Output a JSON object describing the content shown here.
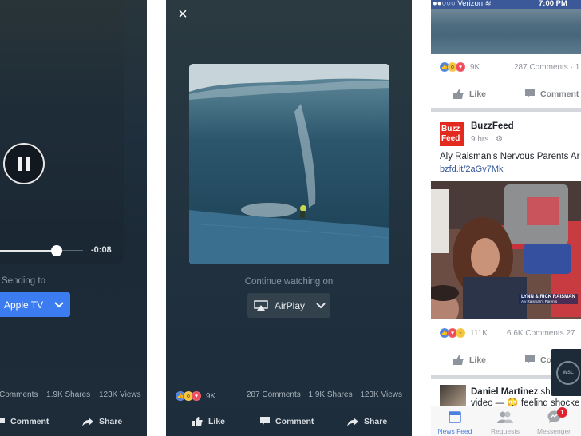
{
  "left_phone": {
    "playback": {
      "time_remaining": "-0:08",
      "progress_percent": 68
    },
    "cast": {
      "label": "Sending to",
      "device": "Apple TV"
    },
    "stats": {
      "comments": "Comments",
      "shares": "1.9K Shares",
      "views": "123K Views"
    },
    "actions": {
      "comment": "Comment",
      "share": "Share"
    }
  },
  "middle_phone": {
    "close_icon": "×",
    "cast": {
      "label": "Continue watching on",
      "device": "AirPlay"
    },
    "reactions": {
      "icons": [
        "like",
        "wow",
        "love"
      ],
      "count": "9K"
    },
    "stats": {
      "comments": "287 Comments",
      "shares": "1.9K Shares",
      "views": "123K Views"
    },
    "actions": {
      "like": "Like",
      "comment": "Comment",
      "share": "Share"
    }
  },
  "right_phone": {
    "status_bar": {
      "carrier": "●●○○○ Verizon",
      "time": "7:00 PM"
    },
    "post1": {
      "reactions": {
        "icons": [
          "like",
          "wow",
          "love"
        ],
        "count": "9K"
      },
      "comments": "287 Comments · 1",
      "actions": {
        "like": "Like",
        "comment": "Comment"
      }
    },
    "post2": {
      "logo_line1": "Buzz",
      "logo_line2": "Feed",
      "author": "BuzzFeed",
      "meta": "9 hrs · ⚙",
      "text": "Aly Raisman's Nervous Parents Ar",
      "link": "bzfd.it/2aGv7Mk",
      "photo_caption": "LYNN & RICK RAISMAN",
      "photo_subcaption": "Aly Raisman's Parents",
      "reactions": {
        "icons": [
          "like",
          "love",
          "haha"
        ],
        "count": "111K"
      },
      "comments": "6.6K Comments  27",
      "actions": {
        "like": "Like",
        "comment": "Co"
      }
    },
    "post3": {
      "author": "Daniel Martinez",
      "text_suffix": " sh",
      "line2": "video — 😳 feeling shocke"
    },
    "pip_label": "WSL",
    "tab_bar": {
      "tabs": [
        {
          "label": "News Feed",
          "active": true
        },
        {
          "label": "Requests",
          "active": false
        },
        {
          "label": "Messenger",
          "active": false,
          "badge": "1"
        }
      ]
    }
  },
  "colors": {
    "fb_blue": "#3b5998",
    "cast_blue": "#3b7cf0",
    "link_blue": "#365899",
    "buzzfeed_red": "#e32a1f",
    "badge_red": "#e0232e"
  }
}
